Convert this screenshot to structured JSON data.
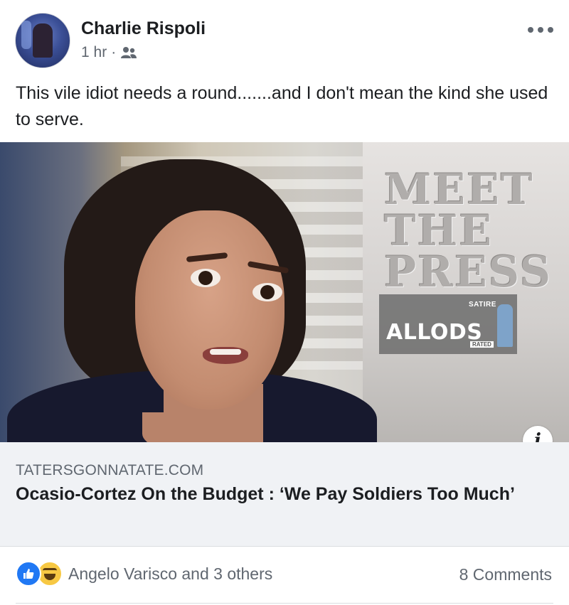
{
  "post": {
    "author": "Charlie Rispoli",
    "time": "1 hr",
    "separator": "·",
    "audience_icon": "friends-icon",
    "more_icon": "more-options-icon",
    "text": "This vile idiot needs a round.......and I don't mean the kind she used to serve."
  },
  "link": {
    "watermark": {
      "satire": "SATIRE",
      "brand": "ALLODS",
      "rated": "RATED"
    },
    "background_sign": "MEET THE PRESS",
    "info_label": "i",
    "domain": "TATERSGONNATATE.COM",
    "title": "Ocasio-Cortez On the Budget : ‘We Pay Soldiers Too Much’"
  },
  "reactions": {
    "icons": [
      "like-icon",
      "haha-icon"
    ],
    "summary": "Angelo Varisco and 3 others",
    "comments": "8 Comments"
  },
  "colors": {
    "like_blue": "#2078f4",
    "haha_yellow": "#f7c843",
    "meta_gray": "#606770",
    "caption_bg": "#f0f2f5"
  }
}
